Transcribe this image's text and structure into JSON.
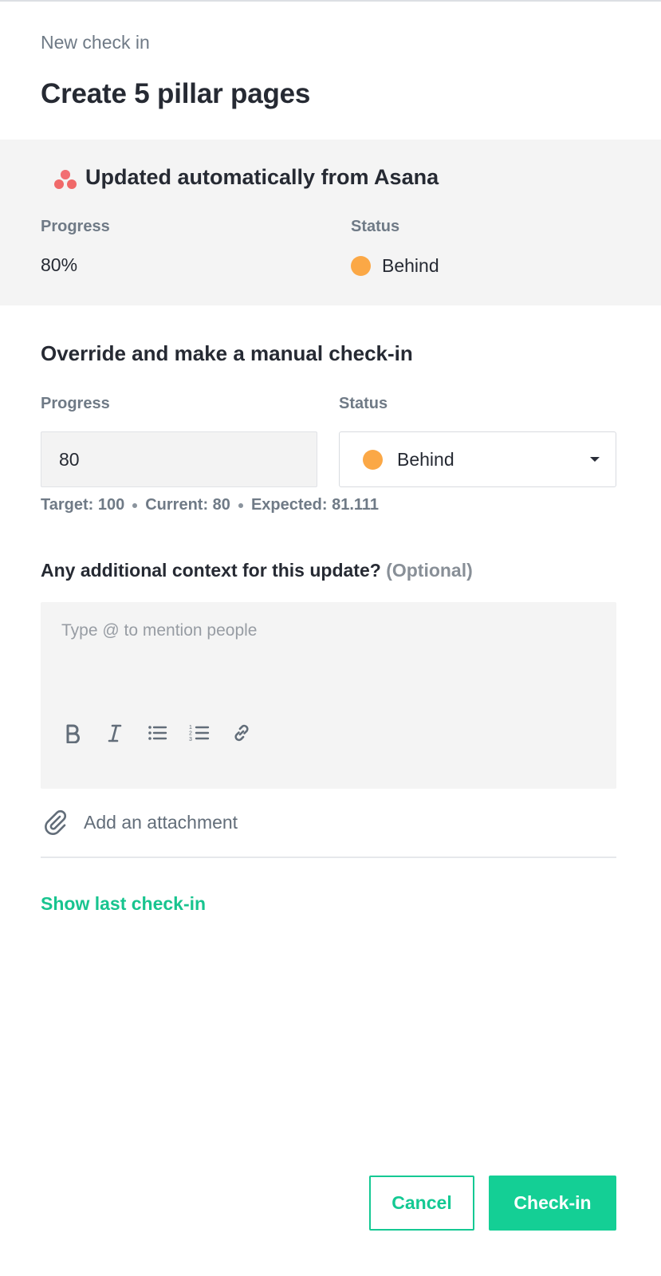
{
  "header": {
    "eyebrow": "New check in",
    "title": "Create 5 pillar pages"
  },
  "auto_update": {
    "heading": "Updated automatically from Asana",
    "logo_icon": "asana-logo",
    "progress_label": "Progress",
    "progress_value": "80%",
    "status_label": "Status",
    "status_value": "Behind",
    "status_color": "#fba846"
  },
  "override": {
    "heading": "Override and make a manual check-in",
    "progress_label": "Progress",
    "progress_value": "80",
    "status_label": "Status",
    "status_selected": "Behind",
    "status_color": "#fba846",
    "target": "Target: 100",
    "current": "Current: 80",
    "expected": "Expected: 81.111"
  },
  "context": {
    "question": "Any additional context for this update?",
    "optional": "(Optional)",
    "placeholder": "Type @ to mention people",
    "toolbar": [
      "bold-icon",
      "italic-icon",
      "bullet-list-icon",
      "numbered-list-icon",
      "link-icon"
    ]
  },
  "attachment": {
    "label": "Add an attachment",
    "icon": "paperclip-icon"
  },
  "show_last_label": "Show last check-in",
  "actions": {
    "cancel_label": "Cancel",
    "checkin_label": "Check-in"
  },
  "colors": {
    "accent": "#14cf95",
    "behind": "#fba846"
  }
}
